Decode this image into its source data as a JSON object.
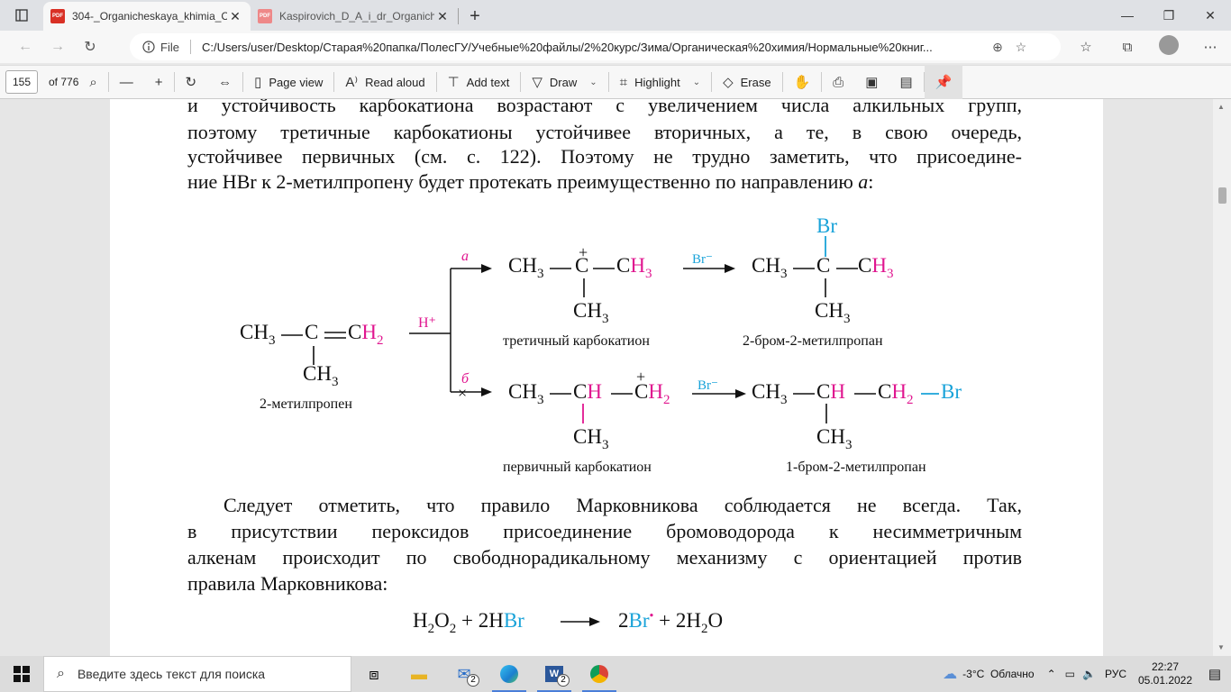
{
  "tabs": [
    {
      "title": "304-_Organicheskaya_khimia_Ch",
      "active": true
    },
    {
      "title": "Kaspirovich_D_A_i_dr_Organiche",
      "active": false
    }
  ],
  "address": {
    "file_label": "File",
    "url": "C:/Users/user/Desktop/Старая%20папка/ПолесГУ/Учебные%20файлы/2%20курс/Зима/Органическая%20химия/Нормальные%20книг..."
  },
  "pdf_toolbar": {
    "page": "155",
    "of_total": "of 776",
    "page_view": "Page view",
    "read_aloud": "Read aloud",
    "add_text": "Add text",
    "draw": "Draw",
    "highlight": "Highlight",
    "erase": "Erase"
  },
  "doc": {
    "para1": [
      "и устойчивость карбокатиона возрастают с увеличением числа алкильных групп,",
      "поэтому третичные карбокатионы устойчивее вторичных, а те, в свою очередь,",
      "устойчивее первичных (см. с. 122). Поэтому не трудно заметить, что присоедине-",
      "ние HBr к 2-метилпропену будет протекать преимущественно по направлению "
    ],
    "para1_italic": "а",
    "para1_end": ":",
    "scheme": {
      "reactant_caption": "2-метилпропен",
      "reagent_h": "H⁺",
      "path_a": "а",
      "path_b": "б",
      "br_minus": "Br⁻",
      "tertiary_caption": "третичный карбокатион",
      "primary_caption": "первичный карбокатион",
      "product1_caption": "2-бром-2-метилпропан",
      "product2_caption": "1-бром-2-метилпропан",
      "ch3": "CH",
      "three": "3",
      "c": "C",
      "h": "H",
      "h2": "H",
      "two": "2",
      "br": "Br",
      "plus": "+",
      "cross": "×"
    },
    "para2": [
      "Следует отметить, что правило Марковникова соблюдается не всегда. Так,",
      "в присутствии пероксидов присоединение бромоводорода к несимметричным",
      "алкенам происходит по свободнорадикальному механизму с ориентацией против",
      "правила Марковникова:"
    ],
    "equation": {
      "h2o2_h": "H",
      "two": "2",
      "o": "O",
      "plus_2h": " + 2H",
      "br": "Br",
      "coef2": "2",
      "dot": "•",
      "plus_2h2o_pre": " + 2H",
      "o_end": "O"
    }
  },
  "taskbar": {
    "search_placeholder": "Введите здесь текст для поиска",
    "mail_badge": "2",
    "word_badge": "2",
    "weather": "-3°C  Облачно",
    "lang": "РУС",
    "time": "22:27",
    "date": "05.01.2022"
  },
  "colors": {
    "magenta": "#e0168f",
    "cyan": "#1aa3d9"
  }
}
